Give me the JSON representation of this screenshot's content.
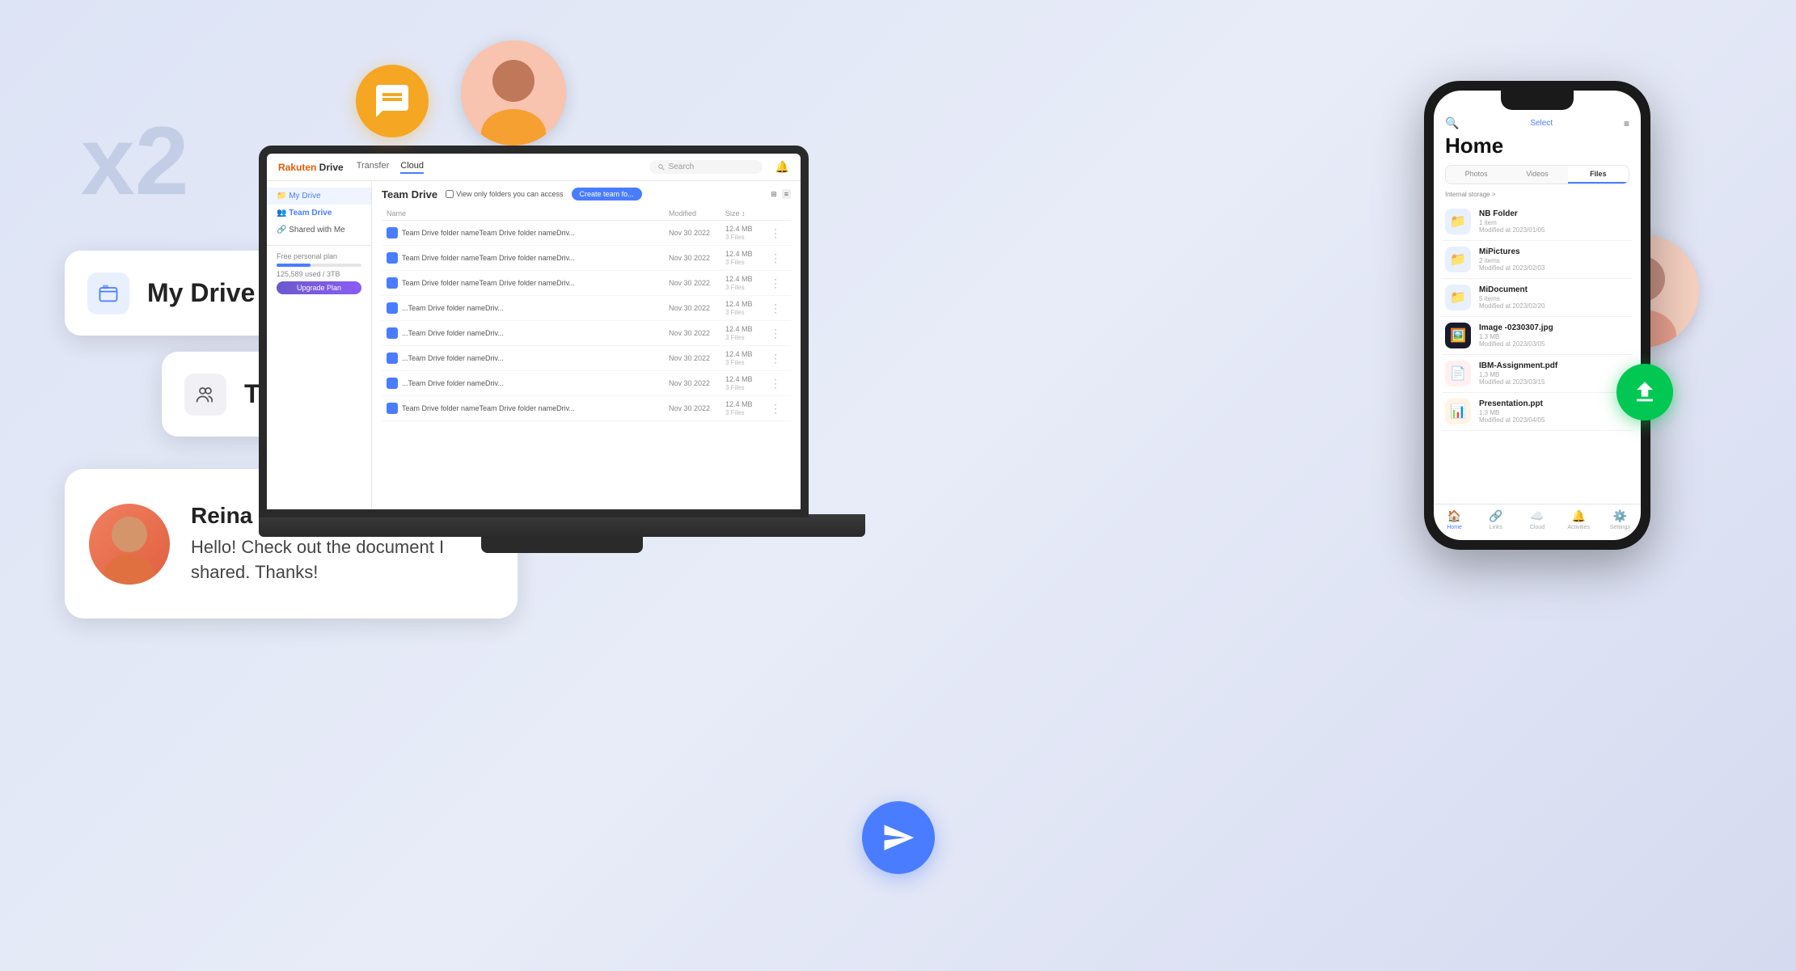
{
  "background_color": "#dde4f5",
  "x2_label": "x2",
  "my_drive": {
    "label": "My Drive",
    "icon": "🗂️"
  },
  "team_drive": {
    "label": "Team Drive",
    "icon": "👥"
  },
  "chat": {
    "name": "Reina",
    "message": "Hello! Check out the document I shared. Thanks!"
  },
  "laptop": {
    "logo": "Rakuten Drive",
    "nav": [
      "Transfer",
      "Cloud"
    ],
    "search_placeholder": "Search",
    "sidebar": {
      "items": [
        "My Drive",
        "Team Drive",
        "Shared with Me"
      ],
      "storage_label": "Free personal plan",
      "storage_used": "125,589 used",
      "storage_total": "3TB",
      "upgrade_label": "Upgrade Plan"
    },
    "main_title": "Team Drive",
    "checkbox_label": "View only folders you can access",
    "create_btn": "Create team fo...",
    "columns": [
      "Name",
      "Modified",
      "Size ↕",
      ""
    ],
    "files": [
      {
        "name": "Team Drive folder nameTeam Drive folder nameDriv...",
        "modified": "Nov 30 2022",
        "size": "12.4 MB",
        "files": "3 Files"
      },
      {
        "name": "Team Drive folder nameTeam Drive folder nameDriv...",
        "modified": "Nov 30 2022",
        "size": "12.4 MB",
        "files": "3 Files"
      },
      {
        "name": "Team Drive folder nameTeam Drive folder nameDriv...",
        "modified": "Nov 30 2022",
        "size": "12.4 MB",
        "files": "3 Files"
      },
      {
        "name": "...Team Drive folder nameDriv...",
        "modified": "Nov 30 2022",
        "size": "12.4 MB",
        "files": "3 Files"
      },
      {
        "name": "...Team Drive folder nameDriv...",
        "modified": "Nov 30 2022",
        "size": "12.4 MB",
        "files": "3 Files"
      },
      {
        "name": "...Team Drive folder nameDriv...",
        "modified": "Nov 30 2022",
        "size": "12.4 MB",
        "files": "3 Files"
      },
      {
        "name": "...Team Drive folder nameDriv...",
        "modified": "Nov 30 2022",
        "size": "12.4 MB",
        "files": "3 Files"
      },
      {
        "name": "Team Drive folder nameTeam Drive folder nameDriv...",
        "modified": "Nov 30 2022",
        "size": "12.4 MB",
        "files": "3 Files"
      }
    ]
  },
  "phone": {
    "title": "Home",
    "select_label": "Select",
    "tabs": [
      "Photos",
      "Videos",
      "Files"
    ],
    "active_tab": "Files",
    "storage_path": "Internal storage >",
    "files": [
      {
        "name": "NB Folder",
        "meta": "1 item\nModified at 2023/01/05",
        "type": "folder"
      },
      {
        "name": "MiPictures",
        "meta": "2 items\nModified at 2023/02/03",
        "type": "folder"
      },
      {
        "name": "MiDocument",
        "meta": "5 items\nModified at 2023/02/20",
        "type": "folder"
      },
      {
        "name": "Image -0230307.jpg",
        "meta": "1.3 MB\nModified at 2023/03/05",
        "type": "image"
      },
      {
        "name": "IBM-Assignment.pdf",
        "meta": "1.3 MB\nModified at 2023/03/15",
        "type": "pdf"
      },
      {
        "name": "Presentation.ppt",
        "meta": "1.3 MB\nModified at 2023/04/05",
        "type": "ppt"
      }
    ],
    "nav": [
      "Home",
      "Links",
      "Cloud",
      "Activities",
      "Settings"
    ]
  }
}
